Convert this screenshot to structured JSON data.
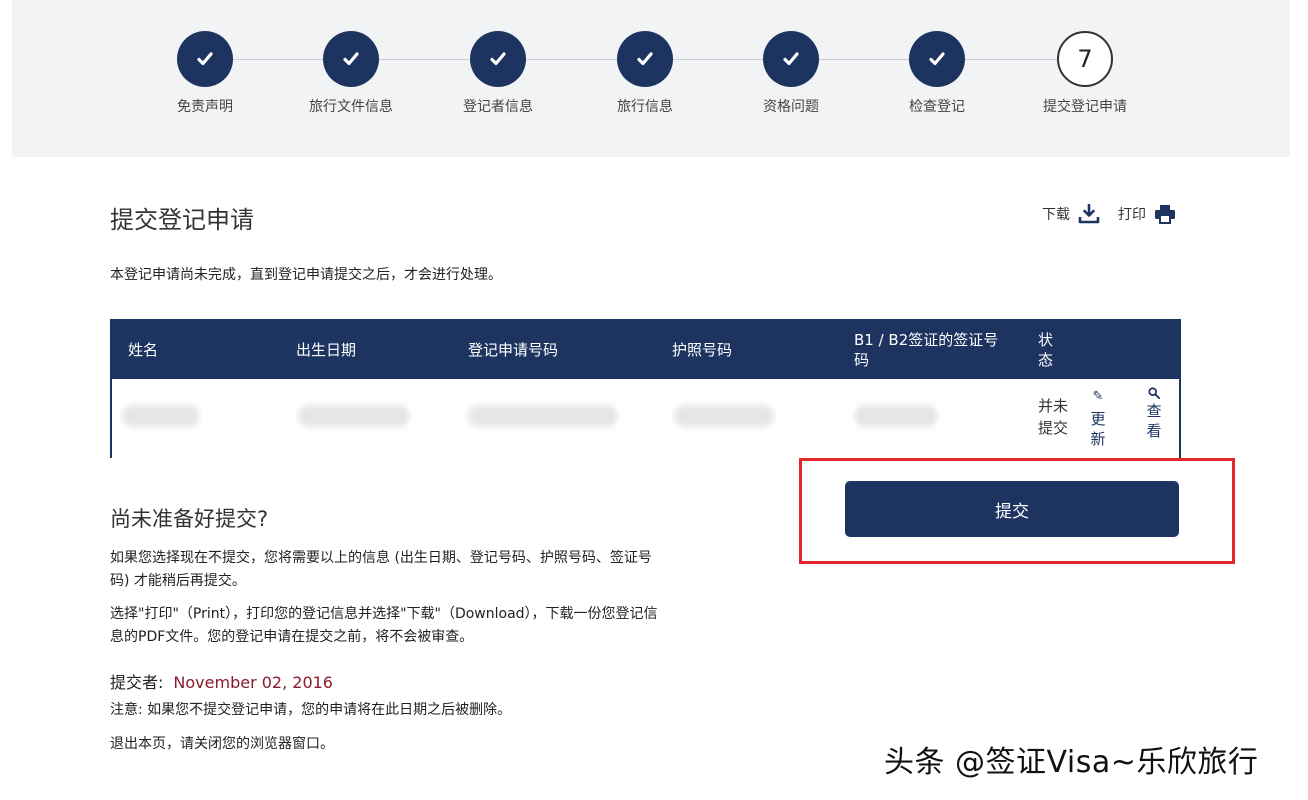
{
  "steps": [
    {
      "label": "免责声明",
      "state": "done"
    },
    {
      "label": "旅行文件信息",
      "state": "done"
    },
    {
      "label": "登记者信息",
      "state": "done"
    },
    {
      "label": "旅行信息",
      "state": "done"
    },
    {
      "label": "资格问题",
      "state": "done"
    },
    {
      "label": "检查登记",
      "state": "done"
    },
    {
      "label": "提交登记申请",
      "state": "current",
      "number": "7"
    }
  ],
  "page": {
    "title": "提交登记申请",
    "intro": "本登记申请尚未完成，直到登记申请提交之后，才会进行处理。"
  },
  "tools": {
    "download_label": "下载",
    "print_label": "打印"
  },
  "table": {
    "headers": {
      "name": "姓名",
      "dob": "出生日期",
      "app_number": "登记申请号码",
      "passport": "护照号码",
      "visa_number_line1": "B1 / B2签证的签证号",
      "visa_number_line2": "码",
      "status_line1": "状",
      "status_line2": "态"
    },
    "row": {
      "status_line1": "并未",
      "status_line2": "提交",
      "update_line1": "更",
      "update_line2": "新",
      "view_line1": "查",
      "view_line2": "看"
    }
  },
  "submit": {
    "label": "提交"
  },
  "not_ready": {
    "heading": "尚未准备好提交?",
    "para1_line1": "如果您选择现在不提交，您将需要以上的信息 (出生日期、登记号码、护照号码、签证号",
    "para1_line2": "码) 才能稍后再提交。",
    "para2_line1": "选择\"打印\"（Print），打印您的登记信息并选择\"下载\"（Download），下载一份您登记信",
    "para2_line2": "息的PDF文件。您的登记申请在提交之前，将不会被审查。",
    "submit_by_label": "提交者:",
    "submit_by_date": "November 02, 2016",
    "note": "注意: 如果您不提交登记申请，您的申请将在此日期之后被删除。",
    "exit": "退出本页，请关闭您的浏览器窗口。"
  },
  "watermark": "头条 @签证Visa~乐欣旅行",
  "colors": {
    "navy": "#1d3461",
    "highlight_red": "#e3262c",
    "date_red": "#8a1b2b",
    "stepper_bg": "#f2f3f5"
  }
}
